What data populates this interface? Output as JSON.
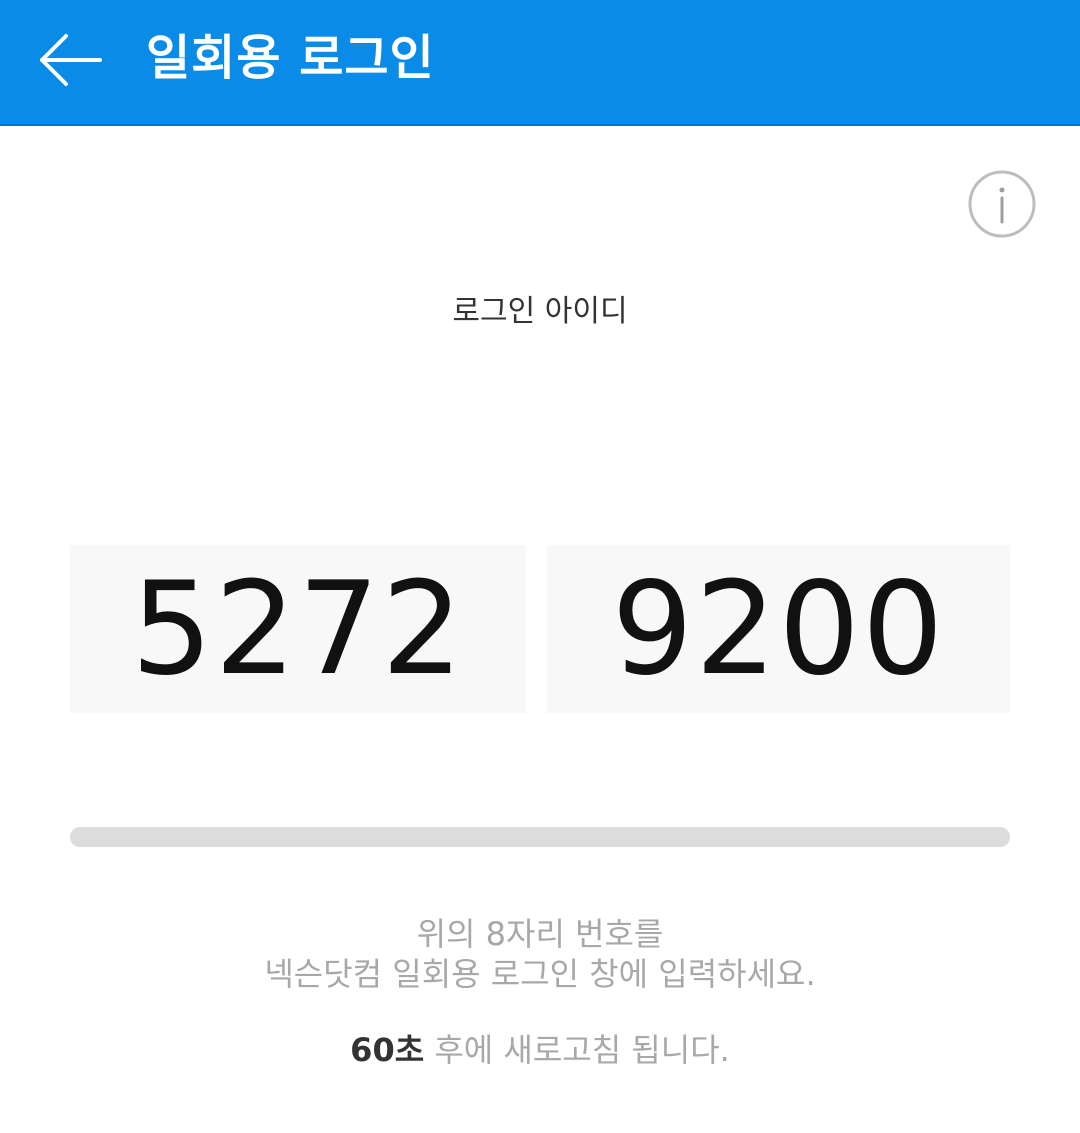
{
  "header": {
    "title": "일회용 로그인",
    "back_icon": "arrow-left-icon",
    "background_color": "#0a8be8"
  },
  "info": {
    "icon": "info-icon"
  },
  "login_id": {
    "label": "로그인 아이디",
    "code_part_1": "5272",
    "code_part_2": "9200"
  },
  "timer": {
    "progress_fraction": 1.0
  },
  "instructions": {
    "line1": "위의 8자리 번호를",
    "line2": "넥슨닷컴 일회용 로그인 창에 입력하세요."
  },
  "refresh": {
    "seconds": "60초",
    "suffix": " 후에 새로고침 됩니다."
  }
}
